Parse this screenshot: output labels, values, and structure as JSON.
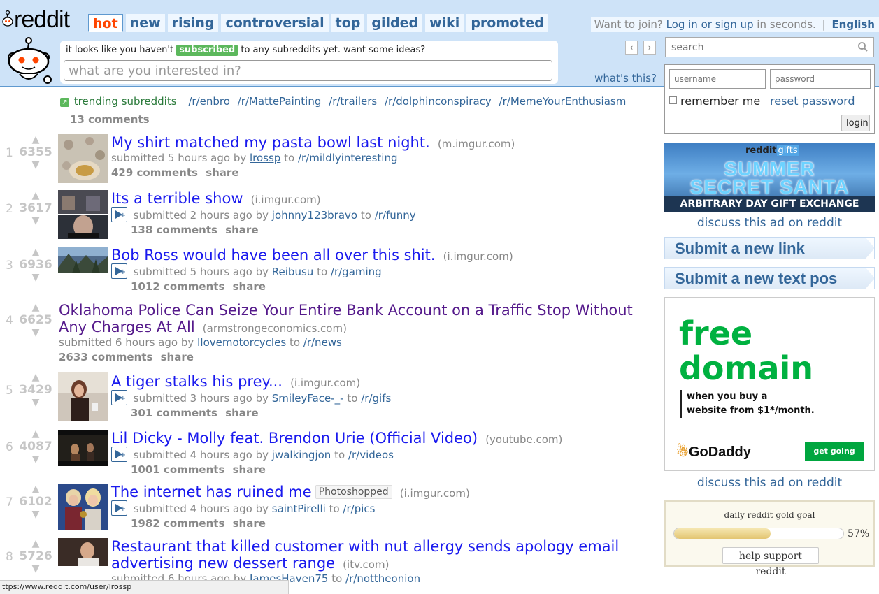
{
  "header": {
    "logo_text": "reddit",
    "tabs": [
      "hot",
      "new",
      "rising",
      "controversial",
      "top",
      "gilded",
      "wiki",
      "promoted"
    ],
    "selected_tab": "hot",
    "userbar": {
      "prefix": "Want to join?",
      "login_link": "Log in or sign up",
      "suffix": "in seconds.",
      "separator": "|",
      "language": "English"
    }
  },
  "welcome": {
    "text_before": "it looks like you haven't",
    "badge": "subscribed",
    "text_after": "to any subreddits yet. want some ideas?",
    "input_placeholder": "what are you interested in?",
    "prev_icon": "chevron-left-icon",
    "next_icon": "chevron-right-icon",
    "whats_this": "what's this?"
  },
  "trending": {
    "label": "trending subreddits",
    "subreddits": [
      "/r/enbro",
      "/r/MattePainting",
      "/r/trailers",
      "/r/dolphinconspiracy",
      "/r/MemeYourEnthusiasm"
    ],
    "comments": "13 comments"
  },
  "links": [
    {
      "rank": "1",
      "score": "6355",
      "title": "My shirt matched my pasta bowl last night.",
      "domain": "(m.imgur.com)",
      "submitted": "submitted 5 hours ago by",
      "author": "lrossp",
      "to": "to",
      "subreddit": "/r/mildlyinteresting",
      "comments": "429 comments",
      "share": "share",
      "has_thumb": true,
      "has_expando": false,
      "visited": false,
      "flair": ""
    },
    {
      "rank": "2",
      "score": "3617",
      "title": "Its a terrible show",
      "domain": "(i.imgur.com)",
      "submitted": "submitted 2 hours ago by",
      "author": "johnny123bravo",
      "to": "to",
      "subreddit": "/r/funny",
      "comments": "138 comments",
      "share": "share",
      "has_thumb": true,
      "has_expando": true,
      "visited": false,
      "flair": ""
    },
    {
      "rank": "3",
      "score": "6936",
      "title": "Bob Ross would have been all over this shit.",
      "domain": "(i.imgur.com)",
      "submitted": "submitted 5 hours ago by",
      "author": "Reibusu",
      "to": "to",
      "subreddit": "/r/gaming",
      "comments": "1012 comments",
      "share": "share",
      "has_thumb": true,
      "has_expando": true,
      "visited": false,
      "flair": ""
    },
    {
      "rank": "4",
      "score": "6625",
      "title": "Oklahoma Police Can Seize Your Entire Bank Account on a Traffic Stop Without Any Charges At All",
      "domain": "(armstrongeconomics.com)",
      "submitted": "submitted 6 hours ago by",
      "author": "Ilovemotorcycles",
      "to": "to",
      "subreddit": "/r/news",
      "comments": "2633 comments",
      "share": "share",
      "has_thumb": false,
      "has_expando": false,
      "visited": true,
      "flair": ""
    },
    {
      "rank": "5",
      "score": "3429",
      "title": "A tiger stalks his prey...",
      "domain": "(i.imgur.com)",
      "submitted": "submitted 3 hours ago by",
      "author": "SmileyFace-_-",
      "to": "to",
      "subreddit": "/r/gifs",
      "comments": "301 comments",
      "share": "share",
      "has_thumb": true,
      "has_expando": true,
      "visited": false,
      "flair": ""
    },
    {
      "rank": "6",
      "score": "4087",
      "title": "Lil Dicky - Molly feat. Brendon Urie (Official Video)",
      "domain": "(youtube.com)",
      "submitted": "submitted 4 hours ago by",
      "author": "jwalkingjon",
      "to": "to",
      "subreddit": "/r/videos",
      "comments": "1001 comments",
      "share": "share",
      "has_thumb": true,
      "has_expando": true,
      "visited": false,
      "flair": ""
    },
    {
      "rank": "7",
      "score": "6102",
      "title": "The internet has ruined me",
      "domain": "(i.imgur.com)",
      "submitted": "submitted 4 hours ago by",
      "author": "saintPirelli",
      "to": "to",
      "subreddit": "/r/pics",
      "comments": "1982 comments",
      "share": "share",
      "has_thumb": true,
      "has_expando": true,
      "visited": false,
      "flair": "Photoshopped"
    },
    {
      "rank": "8",
      "score": "5726",
      "title": "Restaurant that killed customer with nut allergy sends apology email advertising new dessert range",
      "domain": "(itv.com)",
      "submitted": "submitted 6 hours ago by",
      "author": "JamesHaven75",
      "to": "to",
      "subreddit": "/r/nottheonion",
      "comments": "",
      "share": "",
      "has_thumb": true,
      "has_expando": false,
      "visited": false,
      "flair": ""
    }
  ],
  "sidebar": {
    "search_placeholder": "search",
    "login": {
      "username_placeholder": "username",
      "password_placeholder": "password",
      "remember_me": "remember me",
      "reset_password": "reset password",
      "login_button": "login"
    },
    "ad_banner": {
      "brand": "reddit",
      "brand_suffix": "gifts",
      "line1": "SUMMER",
      "line2": "SECRET SANTA",
      "strip": "ARBITRARY DAY GIFT EXCHANGE"
    },
    "discuss_ad": "discuss this ad on reddit",
    "submit_link": "Submit a new link",
    "submit_text": "Submit a new text pos",
    "godaddy": {
      "line1": "free",
      "line2": "domain",
      "sub1": "when you buy a",
      "sub2": "website from $1*/month.",
      "brand": "GoDaddy",
      "cta": "get going"
    },
    "discuss_ad_2": "discuss this ad on reddit",
    "gold": {
      "label": "daily reddit gold goal",
      "percent_text": "57%",
      "progress": 0.57,
      "help_button": "help support reddit"
    }
  },
  "status_bar": "ttps://www.reddit.com/user/lrossp",
  "colors": {
    "header_bg": "#cee3f8",
    "link_blue": "#1a1aee",
    "visited_purple": "#551a8b",
    "subreddit_link": "#369",
    "orangered": "#ff4500",
    "trending_green": "#5cb85c"
  }
}
